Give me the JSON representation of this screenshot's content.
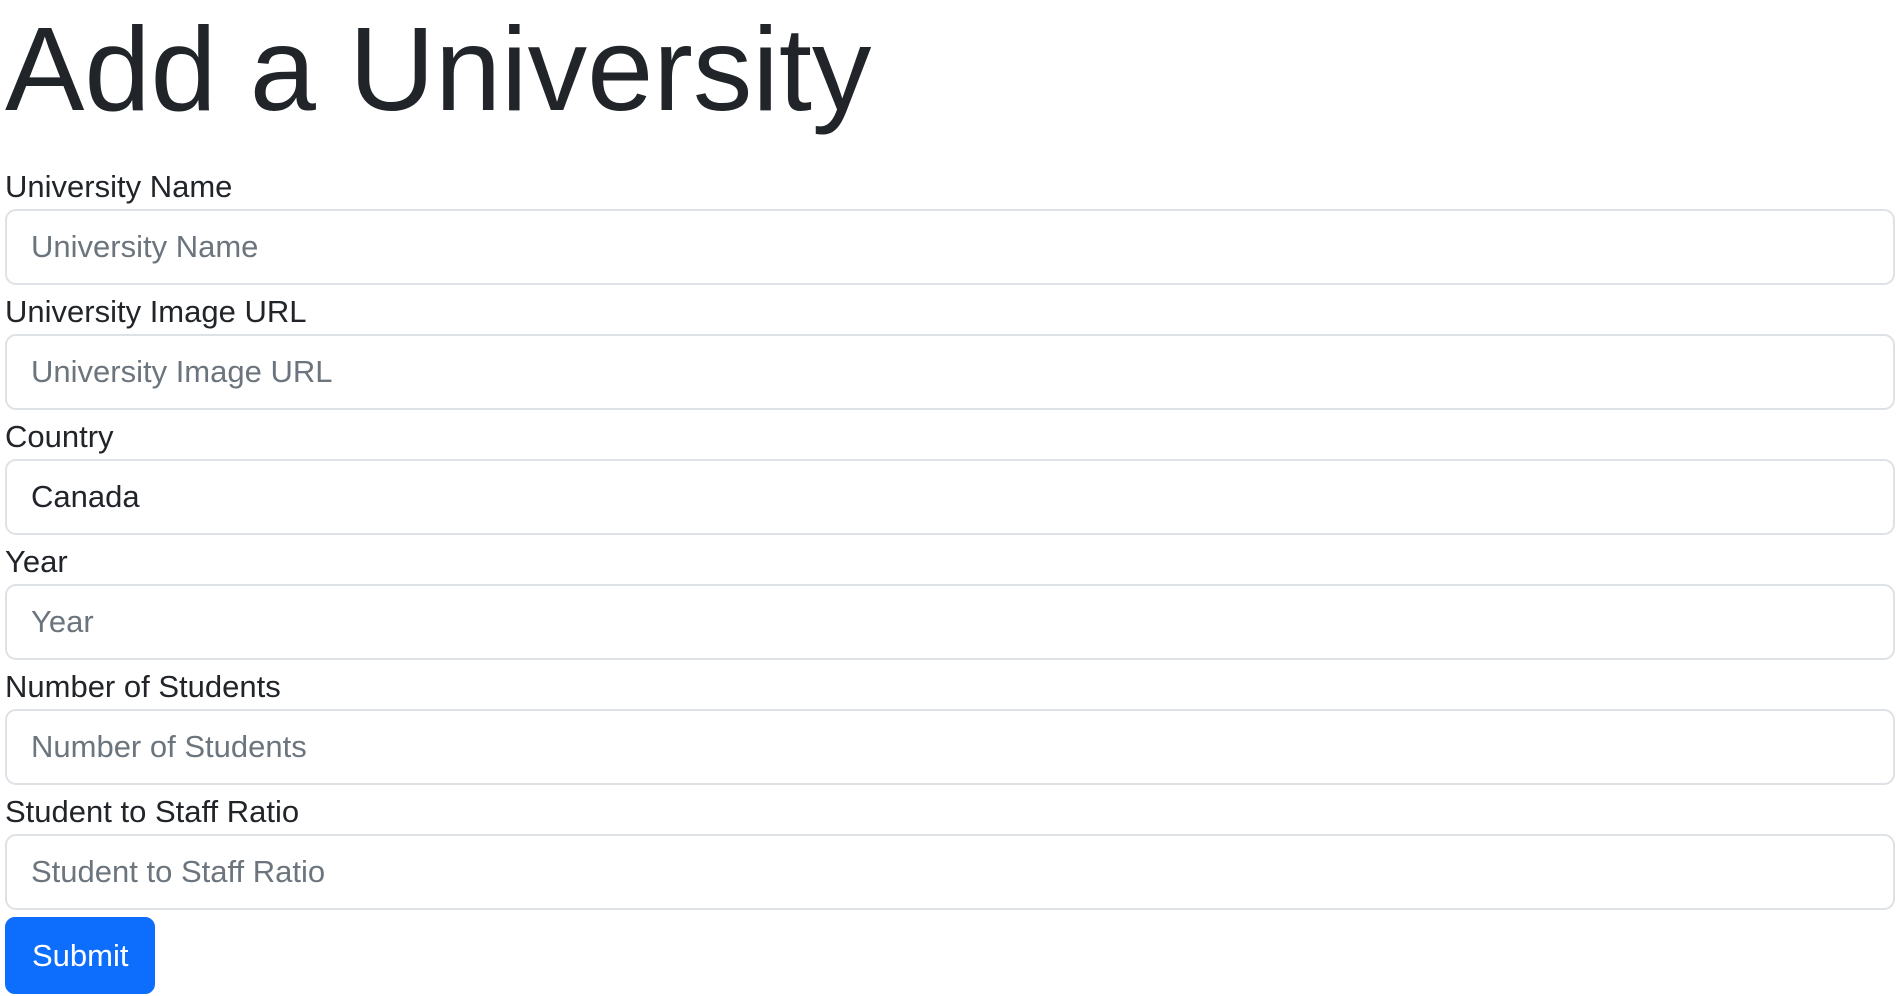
{
  "page": {
    "title": "Add a University"
  },
  "form": {
    "fields": [
      {
        "label": "University Name",
        "placeholder": "University Name",
        "value": ""
      },
      {
        "label": "University Image URL",
        "placeholder": "University Image URL",
        "value": ""
      },
      {
        "label": "Country",
        "placeholder": "Country",
        "value": "Canada"
      },
      {
        "label": "Year",
        "placeholder": "Year",
        "value": ""
      },
      {
        "label": "Number of Students",
        "placeholder": "Number of Students",
        "value": ""
      },
      {
        "label": "Student to Staff Ratio",
        "placeholder": "Student to Staff Ratio",
        "value": ""
      }
    ],
    "submit_label": "Submit"
  },
  "colors": {
    "primary": "#0d6efd",
    "text": "#212529",
    "placeholder": "#6c757d",
    "border": "#dee2e6"
  }
}
